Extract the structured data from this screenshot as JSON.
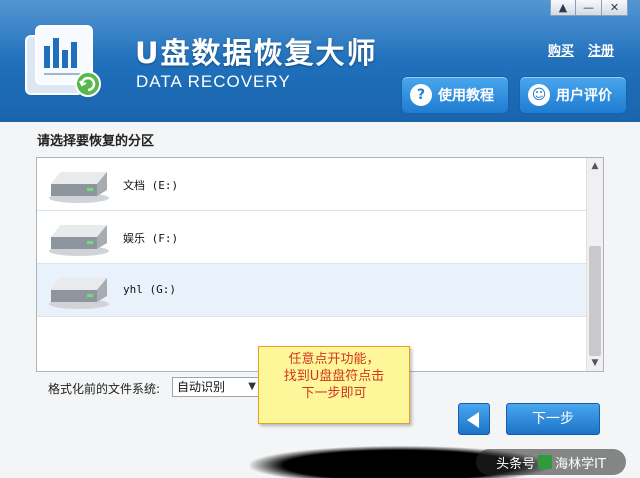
{
  "window": {
    "controls": [
      "▲",
      "—",
      "✕"
    ]
  },
  "header": {
    "title": "U盘数据恢复大师",
    "subtitle": "DATA RECOVERY",
    "links": {
      "buy": "购买",
      "register": "注册"
    },
    "buttons": {
      "tutorial": {
        "icon": "?",
        "label": "使用教程"
      },
      "review": {
        "icon": "☺",
        "label": "用户评价"
      }
    }
  },
  "main": {
    "section_title": "请选择要恢复的分区",
    "partitions": [
      {
        "label": "文档 (E:)"
      },
      {
        "label": "娱乐 (F:)"
      },
      {
        "label": "yhl (G:)"
      }
    ],
    "selected_index": 2
  },
  "footer": {
    "fs_label": "格式化前的文件系统:",
    "fs_value": "自动识别",
    "next_label": "下一步"
  },
  "note": {
    "lines": [
      "任意点开功能，",
      "找到U盘盘符点击",
      "下一步即可"
    ]
  },
  "watermark": {
    "left": "头条号",
    "right": "海林学IT"
  },
  "colors": {
    "header": "#1f6fba",
    "accent": "#1f7cd0",
    "note_bg": "#fdf79a",
    "note_text": "#d43520"
  }
}
